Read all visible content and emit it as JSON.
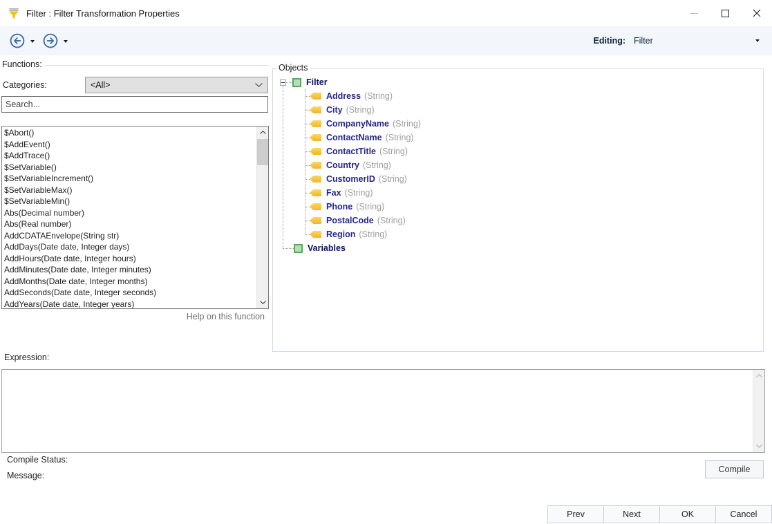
{
  "window": {
    "title": "Filter : Filter Transformation Properties"
  },
  "toolbar": {
    "editing_label": "Editing:",
    "editing_value": "Filter"
  },
  "functions_panel": {
    "group_label": "Functions:",
    "categories_label": "Categories:",
    "categories_value": "<All>",
    "search_placeholder": "Search...",
    "items": [
      "$Abort()",
      "$AddEvent()",
      "$AddTrace()",
      "$SetVariable()",
      "$SetVariableIncrement()",
      "$SetVariableMax()",
      "$SetVariableMin()",
      "Abs(Decimal number)",
      "Abs(Real number)",
      "AddCDATAEnvelope(String str)",
      "AddDays(Date date, Integer days)",
      "AddHours(Date date, Integer hours)",
      "AddMinutes(Date date, Integer minutes)",
      "AddMonths(Date date, Integer months)",
      "AddSeconds(Date date, Integer seconds)",
      "AddYears(Date date, Integer years)"
    ],
    "help_text": "Help on this function"
  },
  "objects_panel": {
    "group_label": "Objects",
    "root_node_label": "Filter",
    "fields": [
      {
        "name": "Address",
        "type": "(String)"
      },
      {
        "name": "City",
        "type": "(String)"
      },
      {
        "name": "CompanyName",
        "type": "(String)"
      },
      {
        "name": "ContactName",
        "type": "(String)"
      },
      {
        "name": "ContactTitle",
        "type": "(String)"
      },
      {
        "name": "Country",
        "type": "(String)"
      },
      {
        "name": "CustomerID",
        "type": "(String)"
      },
      {
        "name": "Fax",
        "type": "(String)"
      },
      {
        "name": "Phone",
        "type": "(String)"
      },
      {
        "name": "PostalCode",
        "type": "(String)"
      },
      {
        "name": "Region",
        "type": "(String)"
      }
    ],
    "variables_node_label": "Variables"
  },
  "expression_panel": {
    "label": "Expression:",
    "value": ""
  },
  "status_panel": {
    "compile_status_label": "Compile Status:",
    "compile_status_value": "",
    "message_label": "Message:",
    "message_value": "",
    "compile_button_label": "Compile"
  },
  "footer": {
    "prev": "Prev",
    "next": "Next",
    "ok": "OK",
    "cancel": "Cancel"
  },
  "icons": {
    "window_icon": "filter-funnel",
    "back": "circle-arrow-left",
    "forward": "circle-arrow-right",
    "dropdown": "caret-down",
    "combobox": "chevron-down",
    "tree_node": "green-square",
    "tree_field": "yellow-field-arrow",
    "expand_collapse": "minus-box"
  },
  "colors": {
    "toolbar_bg": "#f3f6fb",
    "accent_blue": "#3d6fa8",
    "tree_root_text": "#10106b",
    "tree_field_text": "#26268c",
    "tree_type_text": "#9e9e9e",
    "node_icon_fill": "#b5e0b5",
    "node_icon_border": "#58a958",
    "field_icon_gold": "#efb52f",
    "funnel_gold": "#f6bf11"
  }
}
